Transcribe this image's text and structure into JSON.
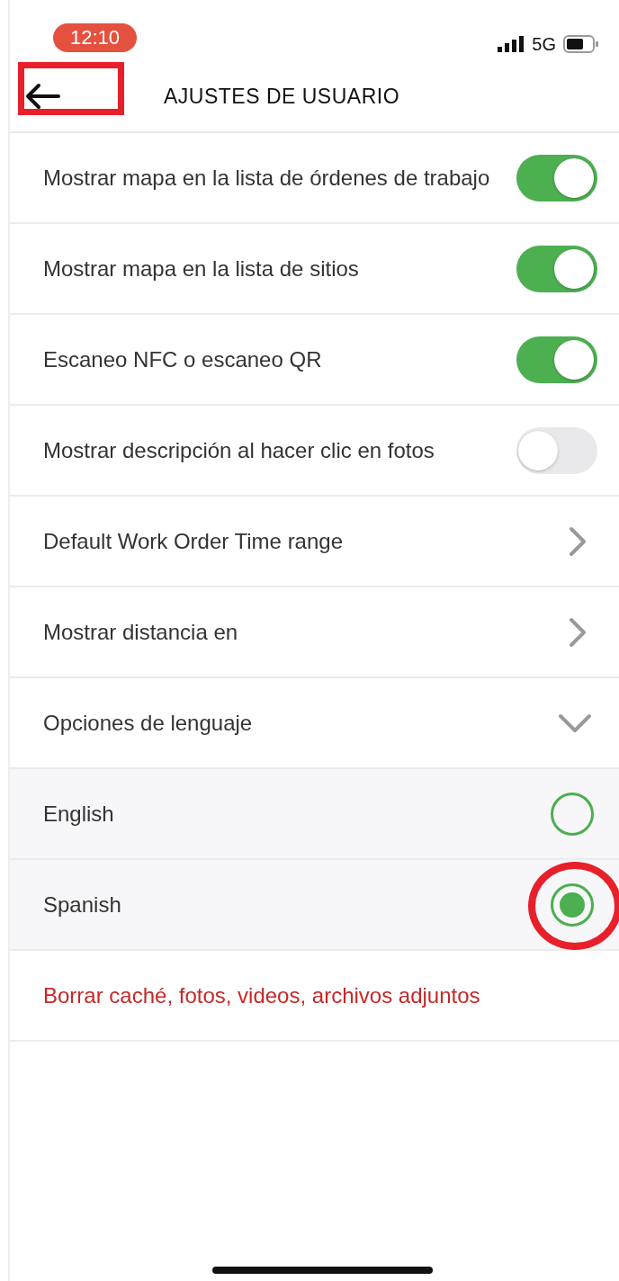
{
  "status_bar": {
    "time": "12:10",
    "network": "5G"
  },
  "header": {
    "title": "AJUSTES DE USUARIO"
  },
  "settings": [
    {
      "kind": "toggle",
      "label": "Mostrar mapa en la lista de órdenes de trabajo",
      "on": true
    },
    {
      "kind": "toggle",
      "label": "Mostrar mapa en la lista de sitios",
      "on": true
    },
    {
      "kind": "toggle",
      "label": "Escaneo NFC o escaneo QR",
      "on": true
    },
    {
      "kind": "toggle",
      "label": "Mostrar descripción al hacer clic en fotos",
      "on": false
    },
    {
      "kind": "link",
      "label": "Default Work Order Time range"
    },
    {
      "kind": "link",
      "label": "Mostrar distancia en"
    },
    {
      "kind": "expander",
      "label": "Opciones de lenguaje",
      "expanded": true
    },
    {
      "kind": "radio",
      "label": "English",
      "selected": false
    },
    {
      "kind": "radio",
      "label": "Spanish",
      "selected": true
    },
    {
      "kind": "action",
      "label": "Borrar caché, fotos, videos, archivos adjuntos"
    }
  ]
}
